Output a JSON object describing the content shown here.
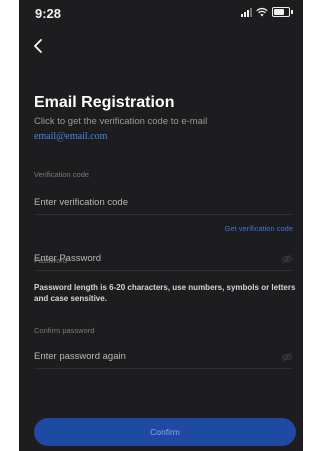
{
  "status_bar": {
    "time": "9:28"
  },
  "header": {
    "title": "Email Registration",
    "subtitle": "Click to get the verification code to e-mail",
    "email": "email@email.com"
  },
  "form": {
    "verification": {
      "label": "Verification code",
      "placeholder": "Enter verification code",
      "get_code_label": "Get verification code"
    },
    "password": {
      "label": "Password",
      "placeholder": "Enter Password",
      "hint": "Password length is 6-20 characters, use numbers, symbols or letters and case sensitive."
    },
    "confirm_password": {
      "label": "Confirm password",
      "placeholder": "Enter password again"
    },
    "confirm_button": "Confirm"
  },
  "colors": {
    "background": "#1d1d1f",
    "accent": "#3f74d8",
    "button": "#1f4aa3"
  },
  "icons": {
    "back": "chevron-left-icon",
    "visibility": "eye-off-icon"
  }
}
